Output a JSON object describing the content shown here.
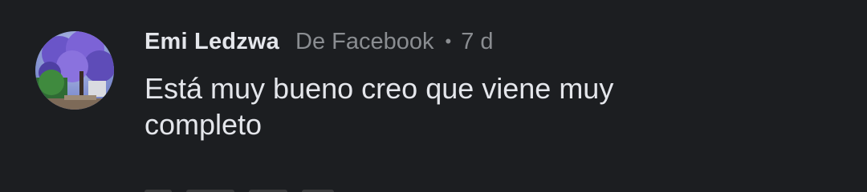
{
  "comment": {
    "author": "Emi Ledzwa",
    "source": "De Facebook",
    "separator": "•",
    "time": "7 d",
    "text": "Está muy bueno creo que viene muy completo",
    "avatar_icon": "profile-photo-jacaranda-tree"
  }
}
